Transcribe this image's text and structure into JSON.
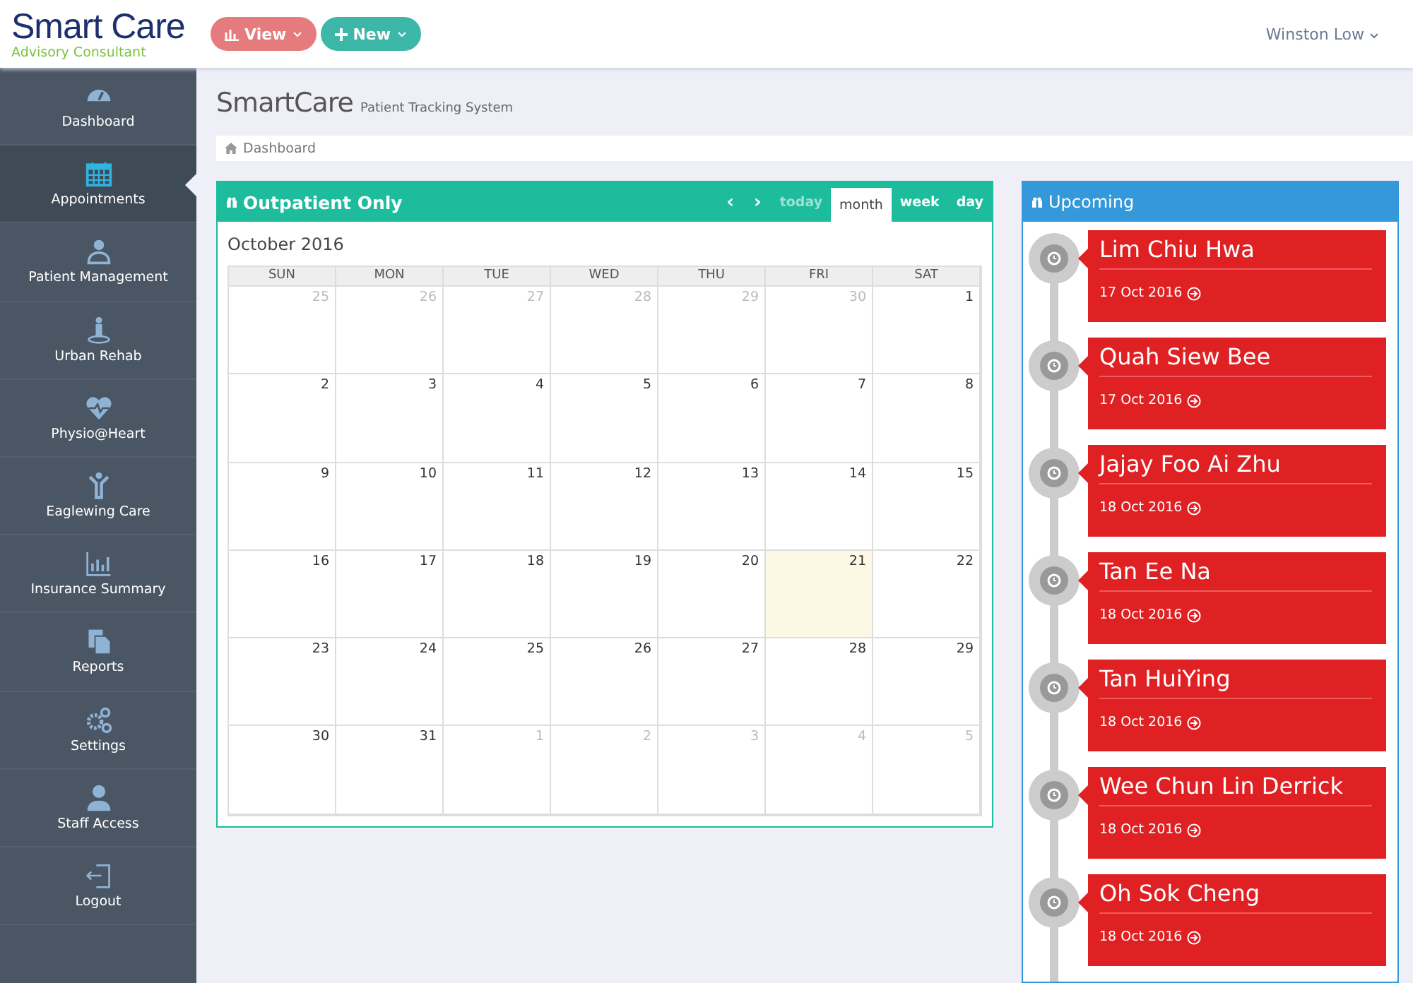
{
  "logo": {
    "name": "Smart Care",
    "tagline": "Advisory Consultant"
  },
  "header_buttons": [
    {
      "label": "View",
      "kind": "view"
    },
    {
      "label": "New",
      "kind": "new"
    }
  ],
  "user": {
    "name": "Winston Low"
  },
  "sidebar": {
    "items": [
      {
        "label": "Dashboard",
        "kind": "gauge",
        "selected": false
      },
      {
        "label": "Appointments",
        "kind": "calendar",
        "selected": true
      },
      {
        "label": "Patient Management",
        "kind": "doctor",
        "selected": false
      },
      {
        "label": "Urban Rehab",
        "kind": "person",
        "selected": false
      },
      {
        "label": "Physio@Heart",
        "kind": "heart",
        "selected": false
      },
      {
        "label": "Eaglewing Care",
        "kind": "child",
        "selected": false
      },
      {
        "label": "Insurance Summary",
        "kind": "chart",
        "selected": false
      },
      {
        "label": "Reports",
        "kind": "files",
        "selected": false
      },
      {
        "label": "Settings",
        "kind": "gears",
        "selected": false
      },
      {
        "label": "Staff Access",
        "kind": "user",
        "selected": false
      },
      {
        "label": "Logout",
        "kind": "logout",
        "selected": false
      }
    ]
  },
  "page": {
    "title": "SmartCare",
    "subtitle": "Patient Tracking System"
  },
  "breadcrumb": [
    "Dashboard"
  ],
  "calendar": {
    "title": "Outpatient Only",
    "prev": "‹",
    "next": "›",
    "today_button": {
      "label": "today",
      "disabled": true
    },
    "views": [
      {
        "label": "month",
        "selected": true
      },
      {
        "label": "week",
        "selected": false
      },
      {
        "label": "day",
        "selected": false
      }
    ],
    "month": "October 2016",
    "weekdays": [
      "SUN",
      "MON",
      "TUE",
      "WED",
      "THU",
      "FRI",
      "SAT"
    ],
    "weeks": [
      [
        {
          "day": "25",
          "other_month": true,
          "today": false
        },
        {
          "day": "26",
          "other_month": true,
          "today": false
        },
        {
          "day": "27",
          "other_month": true,
          "today": false
        },
        {
          "day": "28",
          "other_month": true,
          "today": false
        },
        {
          "day": "29",
          "other_month": true,
          "today": false
        },
        {
          "day": "30",
          "other_month": true,
          "today": false
        },
        {
          "day": "1",
          "other_month": false,
          "today": false
        }
      ],
      [
        {
          "day": "2",
          "other_month": false,
          "today": false
        },
        {
          "day": "3",
          "other_month": false,
          "today": false
        },
        {
          "day": "4",
          "other_month": false,
          "today": false
        },
        {
          "day": "5",
          "other_month": false,
          "today": false
        },
        {
          "day": "6",
          "other_month": false,
          "today": false
        },
        {
          "day": "7",
          "other_month": false,
          "today": false
        },
        {
          "day": "8",
          "other_month": false,
          "today": false
        }
      ],
      [
        {
          "day": "9",
          "other_month": false,
          "today": false
        },
        {
          "day": "10",
          "other_month": false,
          "today": false
        },
        {
          "day": "11",
          "other_month": false,
          "today": false
        },
        {
          "day": "12",
          "other_month": false,
          "today": false
        },
        {
          "day": "13",
          "other_month": false,
          "today": false
        },
        {
          "day": "14",
          "other_month": false,
          "today": false
        },
        {
          "day": "15",
          "other_month": false,
          "today": false
        }
      ],
      [
        {
          "day": "16",
          "other_month": false,
          "today": false
        },
        {
          "day": "17",
          "other_month": false,
          "today": false
        },
        {
          "day": "18",
          "other_month": false,
          "today": false
        },
        {
          "day": "19",
          "other_month": false,
          "today": false
        },
        {
          "day": "20",
          "other_month": false,
          "today": false
        },
        {
          "day": "21",
          "other_month": false,
          "today": true
        },
        {
          "day": "22",
          "other_month": false,
          "today": false
        }
      ],
      [
        {
          "day": "23",
          "other_month": false,
          "today": false
        },
        {
          "day": "24",
          "other_month": false,
          "today": false
        },
        {
          "day": "25",
          "other_month": false,
          "today": false
        },
        {
          "day": "26",
          "other_month": false,
          "today": false
        },
        {
          "day": "27",
          "other_month": false,
          "today": false
        },
        {
          "day": "28",
          "other_month": false,
          "today": false
        },
        {
          "day": "29",
          "other_month": false,
          "today": false
        }
      ],
      [
        {
          "day": "30",
          "other_month": false,
          "today": false
        },
        {
          "day": "31",
          "other_month": false,
          "today": false
        },
        {
          "day": "1",
          "other_month": true,
          "today": false
        },
        {
          "day": "2",
          "other_month": true,
          "today": false
        },
        {
          "day": "3",
          "other_month": true,
          "today": false
        },
        {
          "day": "4",
          "other_month": true,
          "today": false
        },
        {
          "day": "5",
          "other_month": true,
          "today": false
        }
      ]
    ]
  },
  "upcoming": {
    "title": "Upcoming",
    "items": [
      {
        "name": "Lim Chiu Hwa",
        "date": "17 Oct 2016"
      },
      {
        "name": "Quah Siew Bee",
        "date": "17 Oct 2016"
      },
      {
        "name": "Jajay Foo Ai Zhu",
        "date": "18 Oct 2016"
      },
      {
        "name": "Tan Ee Na",
        "date": "18 Oct 2016"
      },
      {
        "name": "Tan HuiYing",
        "date": "18 Oct 2016"
      },
      {
        "name": "Wee Chun Lin Derrick",
        "date": "18 Oct 2016"
      },
      {
        "name": "Oh Sok Cheng",
        "date": "18 Oct 2016"
      }
    ]
  }
}
